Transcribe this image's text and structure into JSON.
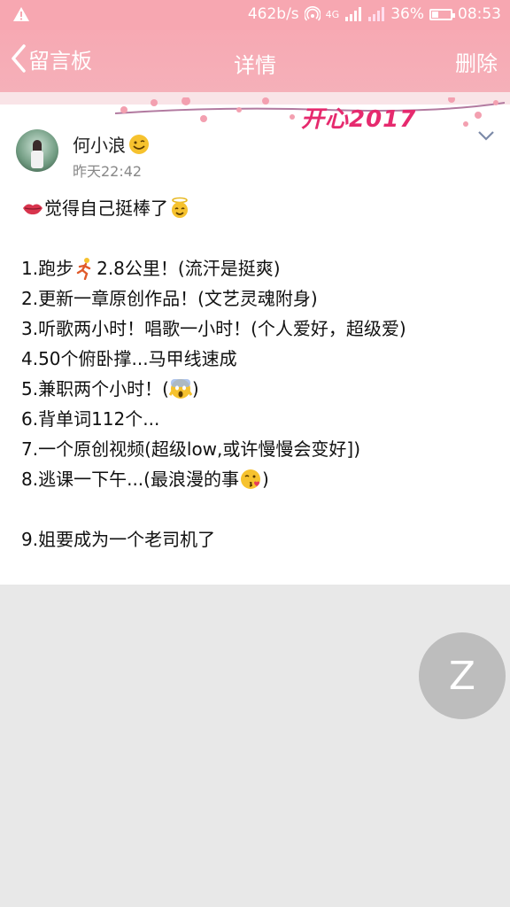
{
  "status_bar": {
    "net_speed": "462b/s",
    "net_type": "4G",
    "battery_percent": "36%",
    "battery_level": 0.36,
    "time": "08:53"
  },
  "header": {
    "back_label": "留言板",
    "title": "详情",
    "delete_label": "删除"
  },
  "banner": {
    "text": "开心2017"
  },
  "post": {
    "author": "何小浪",
    "timestamp": "昨天22:42",
    "intro": "觉得自己挺棒了",
    "items": [
      {
        "before": "1.跑步",
        "emoji": "runner-emoji",
        "after": " 2.8公里！(流汗是挺爽)"
      },
      {
        "before": "2.更新一章原创作品！(文艺灵魂附身)"
      },
      {
        "before": "3.听歌两小时！唱歌一小时！(个人爱好，超级爱)"
      },
      {
        "before": "4.50个俯卧撑...马甲线速成"
      },
      {
        "before": "5.兼职两个小时！(",
        "emoji": "scream-emoji",
        "after": " )"
      },
      {
        "before": "6.背单词112个..."
      },
      {
        "before": "7.一个原创视频(超级low,或许慢慢会变好])"
      },
      {
        "before": "8.逃课一下午...(最浪漫的事",
        "emoji": "kiss-emoji",
        "after": ")"
      }
    ],
    "last_item": "9.姐要成为一个老司机了"
  },
  "fab": {
    "label": "Z"
  },
  "colors": {
    "header_pink": "#f7a9b3",
    "banner_text": "#e62a6e",
    "fab_gray": "#bdbdbd"
  }
}
